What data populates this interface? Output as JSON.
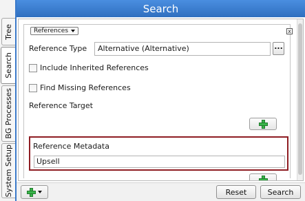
{
  "tabs": [
    {
      "label": "Tree",
      "active": false
    },
    {
      "label": "Search",
      "active": true
    },
    {
      "label": "BG Processes",
      "active": false
    },
    {
      "label": "System Setup",
      "active": false
    }
  ],
  "header": {
    "title": "Search"
  },
  "section": {
    "dropdown_label": "References",
    "close_glyph": "x"
  },
  "reference_type": {
    "label": "Reference Type",
    "value": "Alternative (Alternative)",
    "browse_label": "..."
  },
  "checkboxes": [
    {
      "label": "Include Inherited References",
      "checked": false
    },
    {
      "label": "Find Missing References",
      "checked": false
    }
  ],
  "reference_target": {
    "label": "Reference Target"
  },
  "reference_metadata": {
    "label": "Reference Metadata",
    "value": "Upsell",
    "highlight_color": "#8e1c22"
  },
  "bottom": {
    "reset_label": "Reset",
    "search_label": "Search"
  },
  "colors": {
    "accent": "#3a79c9",
    "add_icon": "#39b54a"
  }
}
